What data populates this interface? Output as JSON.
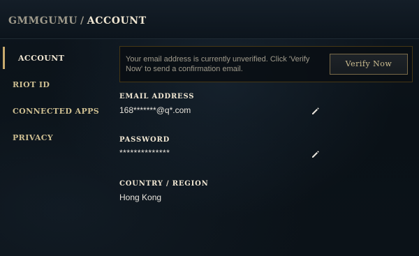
{
  "header": {
    "username": "GMMGUMU",
    "separator": "/",
    "section": "ACCOUNT"
  },
  "sidebar": {
    "items": [
      {
        "label": "ACCOUNT",
        "active": true
      },
      {
        "label": "RIOT ID",
        "active": false
      },
      {
        "label": "CONNECTED APPS",
        "active": false
      },
      {
        "label": "PRIVACY",
        "active": false
      }
    ]
  },
  "notice": {
    "message": "Your email address is currently unverified. Click 'Verify Now' to send a confirmation email.",
    "button_label": "Verify Now"
  },
  "fields": {
    "email": {
      "label": "EMAIL ADDRESS",
      "value": "168*******@q*.com",
      "edit_icon": "pencil-icon"
    },
    "password": {
      "label": "PASSWORD",
      "value": "**************",
      "edit_icon": "pencil-icon"
    },
    "region": {
      "label": "COUNTRY / REGION",
      "value": "Hong Kong"
    }
  },
  "colors": {
    "gold": "#c8aa6e",
    "gold_text": "#cdbe91",
    "light_text": "#f0e6d2",
    "background": "#0a1016"
  }
}
